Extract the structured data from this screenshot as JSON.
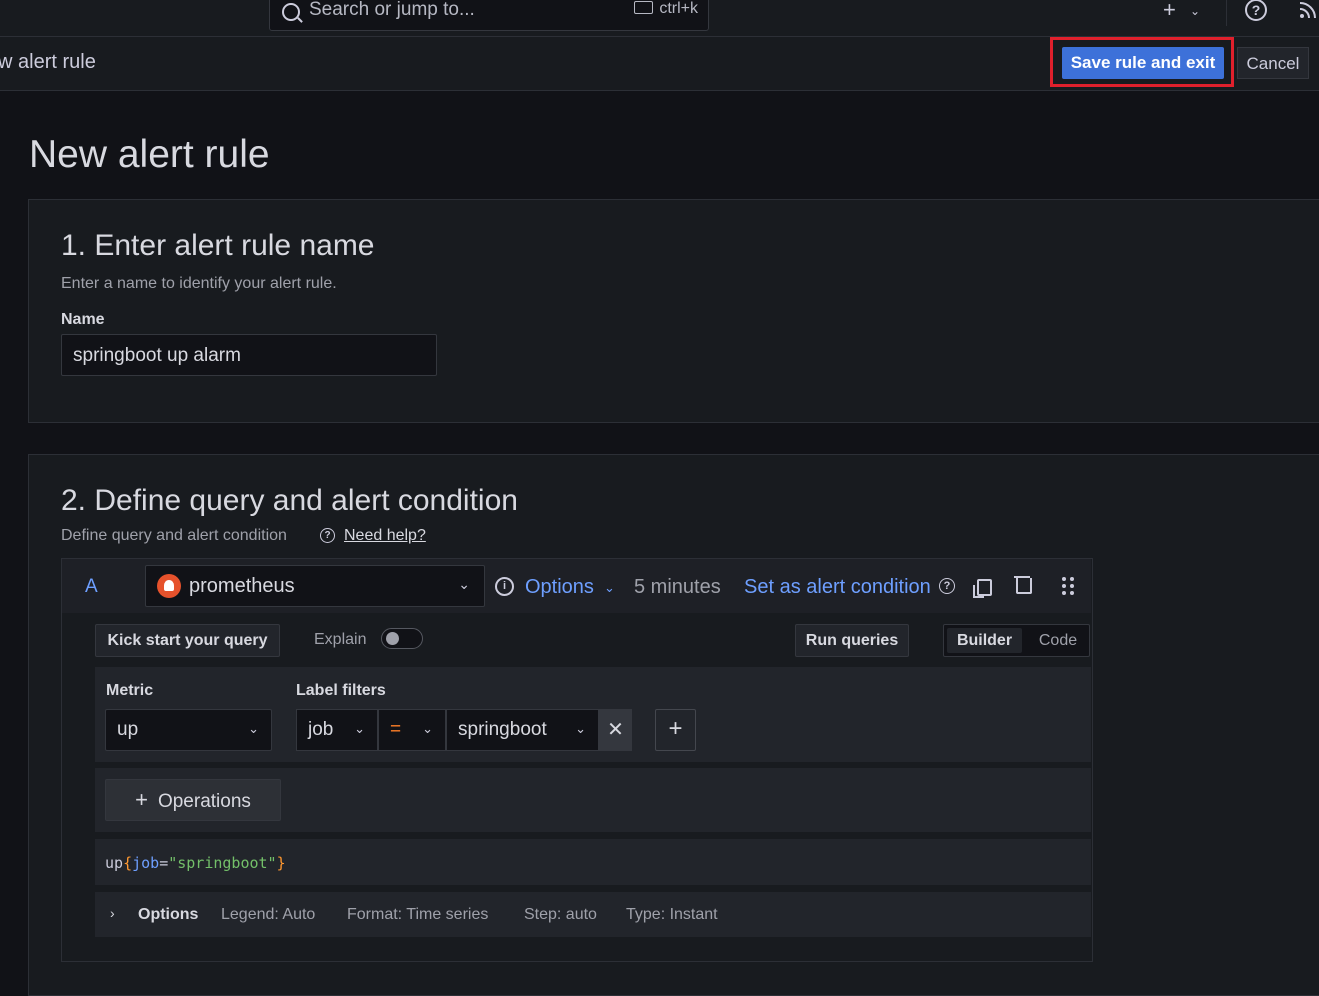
{
  "topbar": {
    "search_placeholder": "Search or jump to...",
    "search_shortcut": "ctrl+k",
    "plus_icon": "+",
    "help_icon": "?",
    "rss_icon": "rss"
  },
  "subbar": {
    "title": "w alert rule",
    "save_label": "Save rule and exit",
    "cancel_label": "Cancel"
  },
  "page": {
    "title": "New alert rule"
  },
  "section1": {
    "title": "1. Enter alert rule name",
    "subtitle": "Enter a name to identify your alert rule.",
    "name_label": "Name",
    "name_value": "springboot up alarm"
  },
  "section2": {
    "title": "2. Define query and alert condition",
    "subtitle": "Define query and alert condition",
    "help_link": "Need help?"
  },
  "query": {
    "ref_id": "A",
    "datasource": "prometheus",
    "options_label": "Options",
    "interval": "5 minutes",
    "set_alert_condition": "Set as alert condition",
    "kick_start_label": "Kick start your query",
    "explain_label": "Explain",
    "explain_enabled": false,
    "run_queries_label": "Run queries",
    "mode_builder": "Builder",
    "mode_code": "Code",
    "selected_mode": "Builder",
    "metric_label": "Metric",
    "metric_value": "up",
    "label_filters_label": "Label filters",
    "filter": {
      "key": "job",
      "operator": "=",
      "value": "springboot"
    },
    "operations_label": "Operations",
    "preview": {
      "metric": "up",
      "open_brace": "{",
      "key": "job",
      "eq": "=",
      "value": "\"springboot\"",
      "close_brace": "}"
    },
    "options_row": {
      "title": "Options",
      "legend": "Legend: Auto",
      "format": "Format: Time series",
      "step": "Step: auto",
      "type": "Type: Instant"
    }
  },
  "colors": {
    "primary": "#3d71d9",
    "link": "#6e9fff",
    "highlight": "#e0202c",
    "background": "#111217",
    "panel": "#181b1f"
  }
}
